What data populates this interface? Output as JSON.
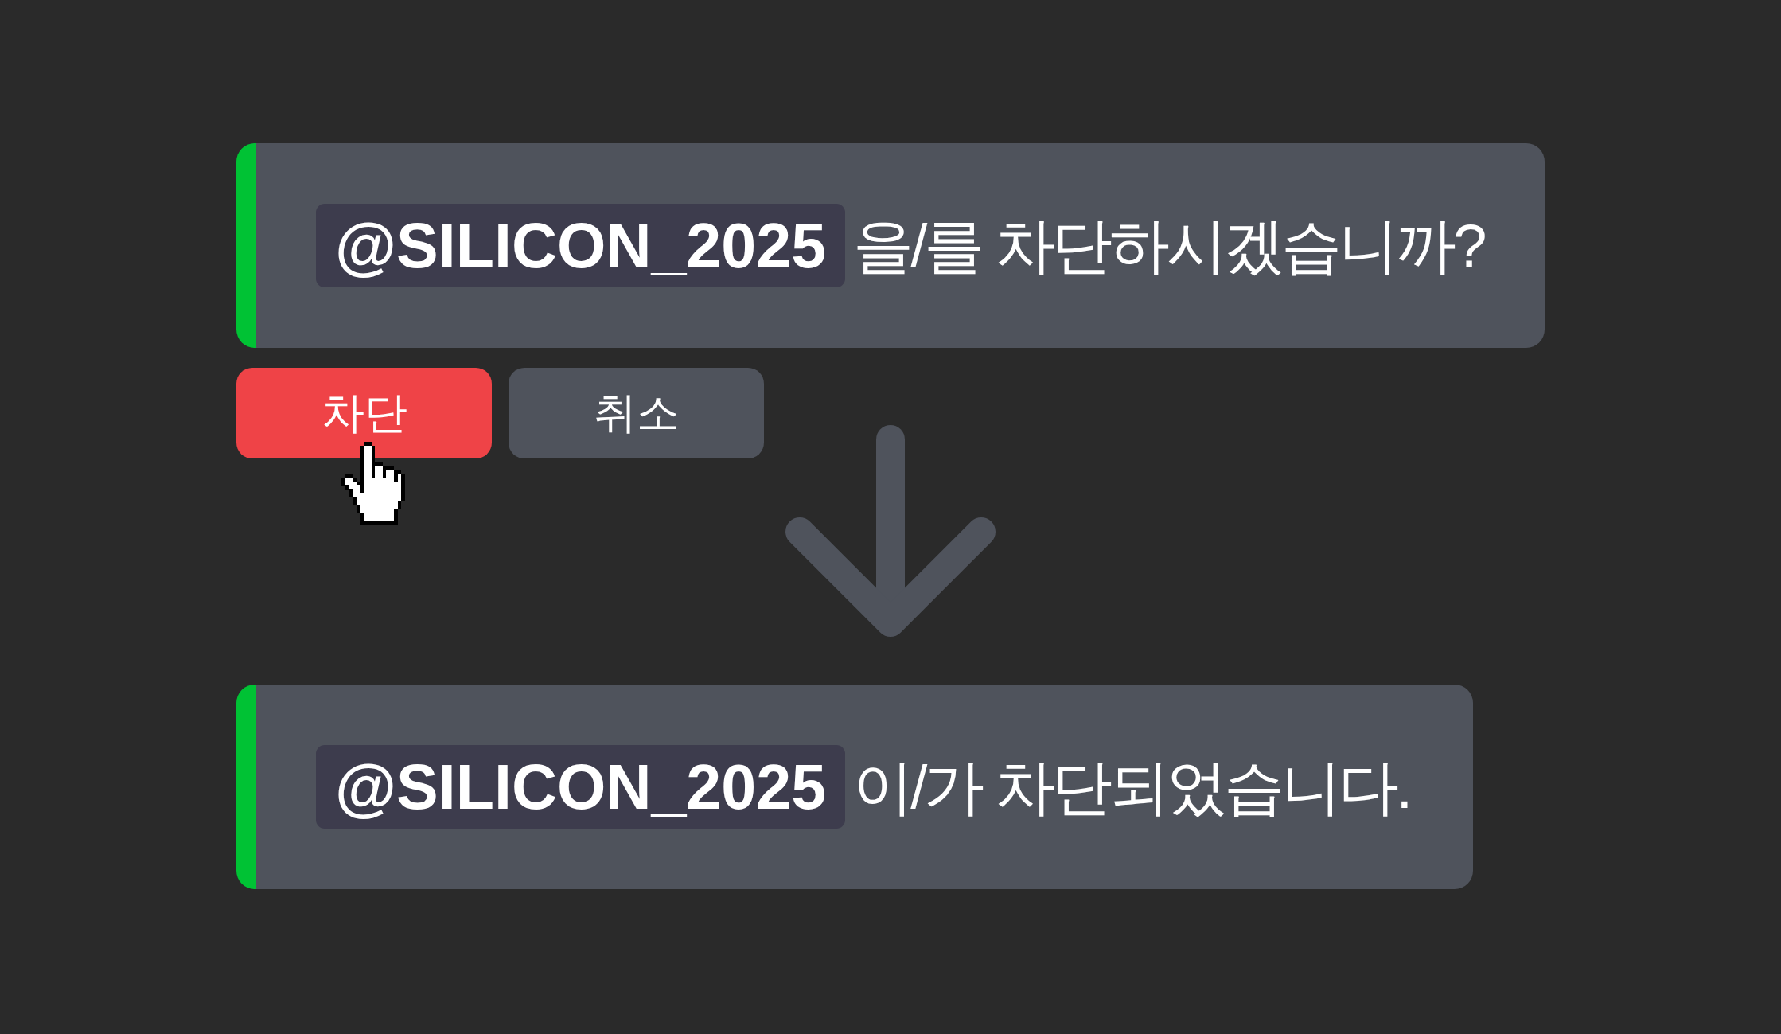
{
  "confirm_message": {
    "mention": "@SILICON_2025",
    "text": "을/를 차단하시겠습니까?"
  },
  "buttons": [
    {
      "label": "차단",
      "kind": "danger",
      "hovered": true
    },
    {
      "label": "취소",
      "kind": "secondary",
      "hovered": false
    }
  ],
  "result_message": {
    "mention": "@SILICON_2025",
    "text": "이/가 차단되었습니다."
  }
}
